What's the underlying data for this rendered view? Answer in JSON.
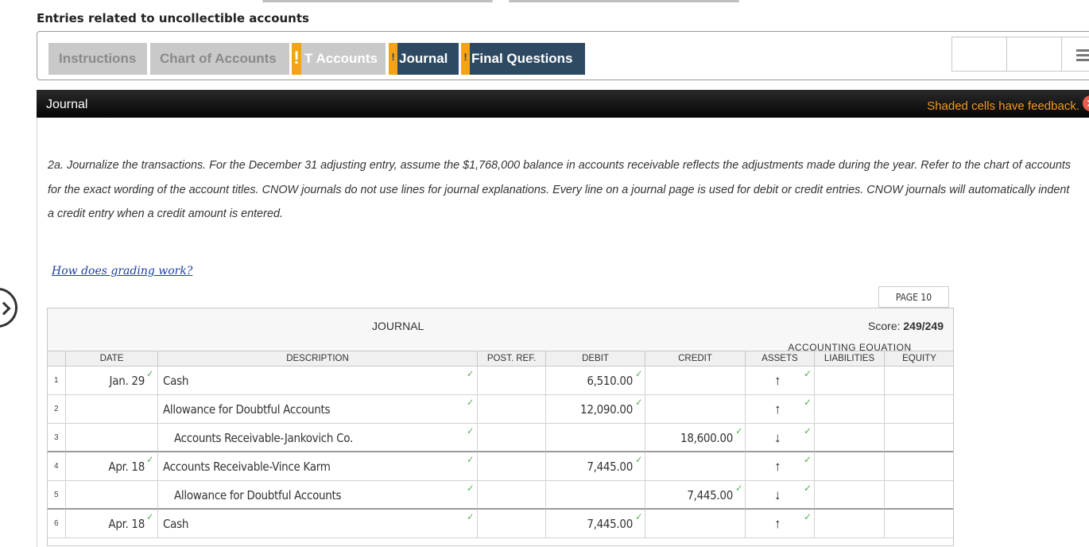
{
  "page": {
    "title": "Entries related to uncollectible accounts"
  },
  "tabs": [
    {
      "label": "Instructions",
      "style": "gray",
      "flag": ""
    },
    {
      "label": "Chart of Accounts",
      "style": "gray",
      "flag": ""
    },
    {
      "label": "T Accounts",
      "style": "gray",
      "flag": "!"
    },
    {
      "label": "Journal",
      "style": "dark",
      "flag": "!"
    },
    {
      "label": "Final Questions",
      "style": "dark",
      "flag": "!"
    }
  ],
  "panel": {
    "title": "Journal",
    "feedback_note": "Shaded cells have feedback.",
    "close_icon": "close-icon"
  },
  "instructions": "2a. Journalize the transactions. For the December 31 adjusting entry, assume the $1,768,000 balance in accounts receivable reflects the adjustments made during the year. Refer to the chart of accounts for the exact wording of the account titles. CNOW journals do not use lines for journal explanations. Every line on a journal page is used for debit or credit entries. CNOW journals will automatically indent a credit entry when a credit amount is entered.",
  "grading_link": "How does grading work?",
  "journal": {
    "page_label": "PAGE 10",
    "title": "JOURNAL",
    "score_label": "Score:",
    "score_value": "249/249",
    "accounting_equation": "ACCOUNTING EQUATION",
    "headers": {
      "date": "DATE",
      "description": "DESCRIPTION",
      "post_ref": "POST. REF.",
      "debit": "DEBIT",
      "credit": "CREDIT",
      "assets": "ASSETS",
      "liabilities": "LIABILITIES",
      "equity": "EQUITY"
    },
    "rows": [
      {
        "num": "1",
        "date": "Jan. 29",
        "description": "Cash",
        "indent": false,
        "debit": "6,510.00",
        "credit": "",
        "assets": "↑",
        "liabilities": "",
        "equity": ""
      },
      {
        "num": "2",
        "date": "",
        "description": "Allowance for Doubtful Accounts",
        "indent": false,
        "debit": "12,090.00",
        "credit": "",
        "assets": "↑",
        "liabilities": "",
        "equity": ""
      },
      {
        "num": "3",
        "date": "",
        "description": "Accounts Receivable-Jankovich Co.",
        "indent": true,
        "debit": "",
        "credit": "18,600.00",
        "assets": "↓",
        "liabilities": "",
        "equity": ""
      },
      {
        "num": "4",
        "date": "Apr. 18",
        "description": "Accounts Receivable-Vince Karm",
        "indent": false,
        "debit": "7,445.00",
        "credit": "",
        "assets": "↑",
        "liabilities": "",
        "equity": ""
      },
      {
        "num": "5",
        "date": "",
        "description": "Allowance for Doubtful Accounts",
        "indent": true,
        "debit": "",
        "credit": "7,445.00",
        "assets": "↓",
        "liabilities": "",
        "equity": ""
      },
      {
        "num": "6",
        "date": "Apr. 18",
        "description": "Cash",
        "indent": false,
        "debit": "7,445.00",
        "credit": "",
        "assets": "↑",
        "liabilities": "",
        "equity": ""
      }
    ]
  },
  "colors": {
    "tab_dark": "#2e4a62",
    "tab_gray": "#c9c9c9",
    "flag": "#f3a316",
    "feedback": "#f39a21",
    "check": "#4caf50",
    "link": "#1b3fa0"
  }
}
